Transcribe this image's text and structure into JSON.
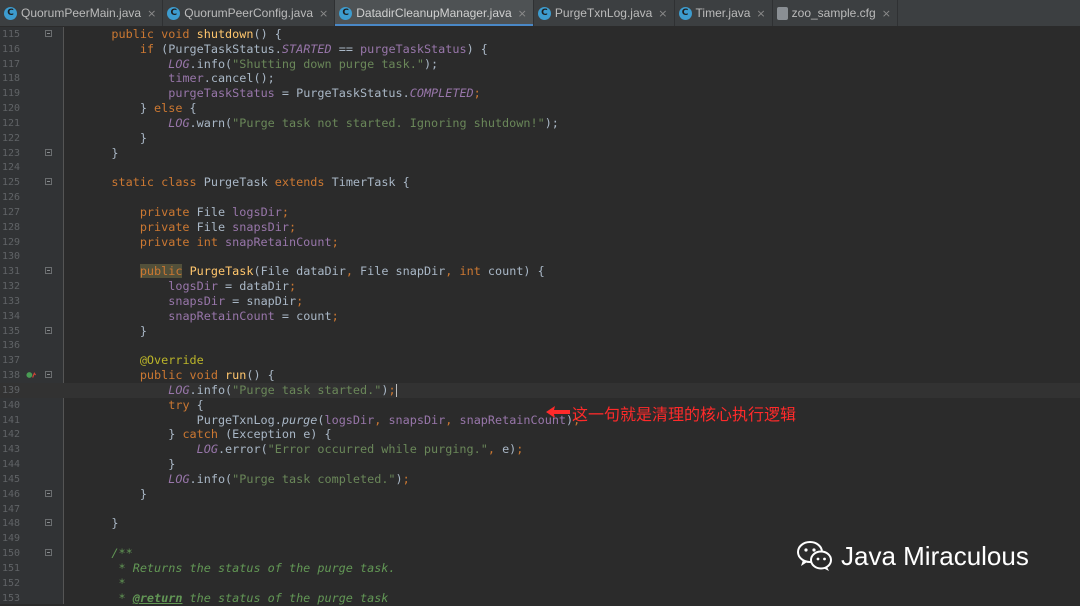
{
  "tabs": [
    {
      "label": "QuorumPeerMain.java",
      "icon": "class-icon",
      "active": false,
      "closable": true
    },
    {
      "label": "QuorumPeerConfig.java",
      "icon": "class-icon",
      "active": false,
      "closable": true
    },
    {
      "label": "DatadirCleanupManager.java",
      "icon": "class-icon",
      "active": true,
      "closable": true
    },
    {
      "label": "PurgeTxnLog.java",
      "icon": "class-icon",
      "active": false,
      "closable": true
    },
    {
      "label": "Timer.java",
      "icon": "class-icon",
      "active": false,
      "closable": true
    },
    {
      "label": "zoo_sample.cfg",
      "icon": "config-file-icon",
      "active": false,
      "closable": true
    }
  ],
  "close_glyph": "×",
  "class_glyph": "C",
  "lines": [
    {
      "n": "115",
      "fold": true,
      "tokens": [
        [
          "    public void ",
          "kw"
        ],
        [
          "shutdown",
          "fn"
        ],
        [
          "() {",
          ""
        ]
      ]
    },
    {
      "n": "116",
      "fold": false,
      "tokens": [
        [
          "        if ",
          "kw"
        ],
        [
          "(PurgeTaskStatus.",
          ""
        ],
        [
          "STARTED",
          "fld it"
        ],
        [
          " == ",
          ""
        ],
        [
          "purgeTaskStatus",
          "fld"
        ],
        [
          ") {",
          ""
        ]
      ]
    },
    {
      "n": "117",
      "fold": false,
      "tokens": [
        [
          "            ",
          ""
        ],
        [
          "LOG",
          "fld it"
        ],
        [
          ".info(",
          ""
        ],
        [
          "\"Shutting down purge task.\"",
          "str"
        ],
        [
          ");",
          ""
        ]
      ]
    },
    {
      "n": "118",
      "fold": false,
      "tokens": [
        [
          "            ",
          ""
        ],
        [
          "timer",
          "fld"
        ],
        [
          ".cancel();",
          ""
        ]
      ]
    },
    {
      "n": "119",
      "fold": false,
      "tokens": [
        [
          "            ",
          ""
        ],
        [
          "purgeTaskStatus",
          "fld"
        ],
        [
          " = PurgeTaskStatus.",
          ""
        ],
        [
          "COMPLETED",
          "fld it"
        ],
        [
          ";",
          "kw"
        ]
      ]
    },
    {
      "n": "120",
      "fold": false,
      "tokens": [
        [
          "        } ",
          ""
        ],
        [
          "else ",
          "kw"
        ],
        [
          "{",
          ""
        ]
      ]
    },
    {
      "n": "121",
      "fold": false,
      "tokens": [
        [
          "            ",
          ""
        ],
        [
          "LOG",
          "fld it"
        ],
        [
          ".warn(",
          ""
        ],
        [
          "\"Purge task not started. Ignoring shutdown!\"",
          "str"
        ],
        [
          ");",
          ""
        ]
      ]
    },
    {
      "n": "122",
      "fold": false,
      "tokens": [
        [
          "        }",
          ""
        ]
      ]
    },
    {
      "n": "123",
      "fold": true,
      "tokens": [
        [
          "    }",
          ""
        ]
      ]
    },
    {
      "n": "124",
      "fold": false,
      "tokens": []
    },
    {
      "n": "125",
      "fold": true,
      "tokens": [
        [
          "    static class ",
          "kw"
        ],
        [
          "PurgeTask ",
          ""
        ],
        [
          "extends ",
          "kw"
        ],
        [
          "TimerTask {",
          ""
        ]
      ]
    },
    {
      "n": "126",
      "fold": false,
      "tokens": []
    },
    {
      "n": "127",
      "fold": false,
      "tokens": [
        [
          "        private ",
          "kw"
        ],
        [
          "File ",
          ""
        ],
        [
          "logsDir",
          "fld"
        ],
        [
          ";",
          "kw"
        ]
      ]
    },
    {
      "n": "128",
      "fold": false,
      "tokens": [
        [
          "        private ",
          "kw"
        ],
        [
          "File ",
          ""
        ],
        [
          "snapsDir",
          "fld"
        ],
        [
          ";",
          "kw"
        ]
      ]
    },
    {
      "n": "129",
      "fold": false,
      "tokens": [
        [
          "        private int ",
          "kw"
        ],
        [
          "snapRetainCount",
          "fld"
        ],
        [
          ";",
          "kw"
        ]
      ]
    },
    {
      "n": "130",
      "fold": false,
      "tokens": []
    },
    {
      "n": "131",
      "fold": true,
      "tokens": [
        [
          "        ",
          ""
        ],
        [
          "public",
          "kw hl"
        ],
        [
          " ",
          ""
        ],
        [
          "PurgeTask",
          "fn"
        ],
        [
          "(File dataDir",
          ""
        ],
        [
          ", ",
          "kw"
        ],
        [
          "File snapDir",
          ""
        ],
        [
          ", ",
          "kw"
        ],
        [
          "int ",
          "kw"
        ],
        [
          "count) {",
          ""
        ]
      ]
    },
    {
      "n": "132",
      "fold": false,
      "tokens": [
        [
          "            ",
          ""
        ],
        [
          "logsDir",
          "fld"
        ],
        [
          " = dataDir",
          ""
        ],
        [
          ";",
          "kw"
        ]
      ]
    },
    {
      "n": "133",
      "fold": false,
      "tokens": [
        [
          "            ",
          ""
        ],
        [
          "snapsDir",
          "fld"
        ],
        [
          " = snapDir",
          ""
        ],
        [
          ";",
          "kw"
        ]
      ]
    },
    {
      "n": "134",
      "fold": false,
      "tokens": [
        [
          "            ",
          ""
        ],
        [
          "snapRetainCount",
          "fld"
        ],
        [
          " = count",
          ""
        ],
        [
          ";",
          "kw"
        ]
      ]
    },
    {
      "n": "135",
      "fold": true,
      "tokens": [
        [
          "        }",
          ""
        ]
      ]
    },
    {
      "n": "136",
      "fold": false,
      "tokens": []
    },
    {
      "n": "137",
      "fold": false,
      "tokens": [
        [
          "        ",
          ""
        ],
        [
          "@Override",
          "ann"
        ]
      ]
    },
    {
      "n": "138",
      "fold": true,
      "run_marker": true,
      "tokens": [
        [
          "        public void ",
          "kw"
        ],
        [
          "run",
          "fn"
        ],
        [
          "() {",
          ""
        ]
      ]
    },
    {
      "n": "139",
      "fold": false,
      "current": true,
      "caret": true,
      "tokens": [
        [
          "            ",
          ""
        ],
        [
          "LOG",
          "fld it"
        ],
        [
          ".info(",
          ""
        ],
        [
          "\"Purge task started.\"",
          "str"
        ],
        [
          ")",
          ""
        ],
        [
          ";",
          "kw"
        ]
      ]
    },
    {
      "n": "140",
      "fold": false,
      "tokens": [
        [
          "            ",
          ""
        ],
        [
          "try ",
          "kw"
        ],
        [
          "{",
          ""
        ]
      ]
    },
    {
      "n": "141",
      "fold": false,
      "tokens": [
        [
          "                PurgeTxnLog.",
          ""
        ],
        [
          "purge",
          "it"
        ],
        [
          "(",
          ""
        ],
        [
          "logsDir",
          "fld"
        ],
        [
          ", ",
          "kw"
        ],
        [
          "snapsDir",
          "fld"
        ],
        [
          ", ",
          "kw"
        ],
        [
          "snapRetainCount",
          "fld"
        ],
        [
          ")",
          ""
        ],
        [
          ";",
          "kw"
        ]
      ]
    },
    {
      "n": "142",
      "fold": false,
      "tokens": [
        [
          "            } ",
          ""
        ],
        [
          "catch ",
          "kw"
        ],
        [
          "(Exception e) {",
          ""
        ]
      ]
    },
    {
      "n": "143",
      "fold": false,
      "tokens": [
        [
          "                ",
          ""
        ],
        [
          "LOG",
          "fld it"
        ],
        [
          ".error(",
          ""
        ],
        [
          "\"Error occurred while purging.\"",
          "str"
        ],
        [
          ", ",
          "kw"
        ],
        [
          "e)",
          ""
        ],
        [
          ";",
          "kw"
        ]
      ]
    },
    {
      "n": "144",
      "fold": false,
      "tokens": [
        [
          "            }",
          ""
        ]
      ]
    },
    {
      "n": "145",
      "fold": false,
      "tokens": [
        [
          "            ",
          ""
        ],
        [
          "LOG",
          "fld it"
        ],
        [
          ".info(",
          ""
        ],
        [
          "\"Purge task completed.\"",
          "str"
        ],
        [
          ")",
          ""
        ],
        [
          ";",
          "kw"
        ]
      ]
    },
    {
      "n": "146",
      "fold": true,
      "tokens": [
        [
          "        }",
          ""
        ]
      ]
    },
    {
      "n": "147",
      "fold": false,
      "tokens": []
    },
    {
      "n": "148",
      "fold": true,
      "tokens": [
        [
          "    }",
          ""
        ]
      ]
    },
    {
      "n": "149",
      "fold": false,
      "tokens": []
    },
    {
      "n": "150",
      "fold": true,
      "tokens": [
        [
          "    /**",
          "cmt"
        ]
      ]
    },
    {
      "n": "151",
      "fold": false,
      "tokens": [
        [
          "     * Returns the status of the purge task.",
          "cmt"
        ]
      ]
    },
    {
      "n": "152",
      "fold": false,
      "tokens": [
        [
          "     *",
          "cmt"
        ]
      ]
    },
    {
      "n": "153",
      "fold": false,
      "tokens": [
        [
          "     * ",
          "cmt"
        ],
        [
          "@return",
          "tag"
        ],
        [
          " the status of the purge task",
          "cmt"
        ]
      ]
    }
  ],
  "annotation": {
    "text": "这一句就是清理的核心执行逻辑",
    "color": "#ff2a2a"
  },
  "watermark": {
    "text": "Java Miraculous"
  },
  "colors": {
    "background": "#2b2b2b",
    "keyword": "#cc7832",
    "string": "#6a8759",
    "field": "#9876aa",
    "method": "#ffc66d",
    "comment": "#629755",
    "annotation": "#bbb529"
  }
}
